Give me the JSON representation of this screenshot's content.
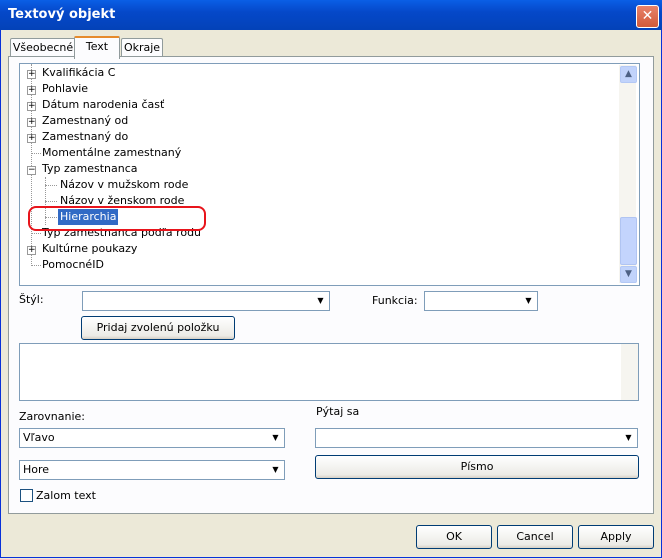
{
  "window": {
    "title": "Textový objekt",
    "close_glyph": "✕"
  },
  "tabs": [
    {
      "label": "Všeobecné"
    },
    {
      "label": "Text",
      "active": true
    },
    {
      "label": "Okraje"
    }
  ],
  "tree": {
    "items": [
      {
        "label": "Kvalifikácia C",
        "expandable": true
      },
      {
        "label": "Pohlavie",
        "expandable": true
      },
      {
        "label": "Dátum narodenia časť",
        "expandable": true
      },
      {
        "label": "Zamestnaný od",
        "expandable": true
      },
      {
        "label": "Zamestnaný do",
        "expandable": true
      },
      {
        "label": "Momentálne zamestnaný",
        "expandable": false
      },
      {
        "label": "Typ zamestnanca",
        "expandable": true,
        "expanded": true
      },
      {
        "label": "Názov v mužskom rode",
        "child": true
      },
      {
        "label": "Názov v ženskom rode",
        "child": true
      },
      {
        "label": "Hierarchia",
        "child": true,
        "selected": true
      },
      {
        "label": "Typ zamestnanca podľa rodu",
        "expandable": false
      },
      {
        "label": "Kultúrne poukazy",
        "expandable": true
      },
      {
        "label": "PomocnéID",
        "expandable": false
      }
    ]
  },
  "style_row": {
    "styl_label": "Štýl:",
    "styl_value": "",
    "funkcia_label": "Funkcia:",
    "funkcia_value": ""
  },
  "add_button_label": "Pridaj zvolenú položku",
  "memo_text": "",
  "alignment": {
    "label": "Zarovnanie:",
    "horizontal_value": "Vľavo",
    "vertical_value": "Hore"
  },
  "ask": {
    "label": "Pýtaj sa",
    "value": ""
  },
  "font_button_label": "Písmo",
  "wrap_checkbox": {
    "label": "Zalom text",
    "checked": false
  },
  "footer": {
    "ok_label": "OK",
    "cancel_label": "Cancel",
    "apply_label": "Apply"
  },
  "icons": {
    "expand": "+",
    "collapse": "−",
    "arrow_up": "▲",
    "arrow_down": "▼"
  }
}
